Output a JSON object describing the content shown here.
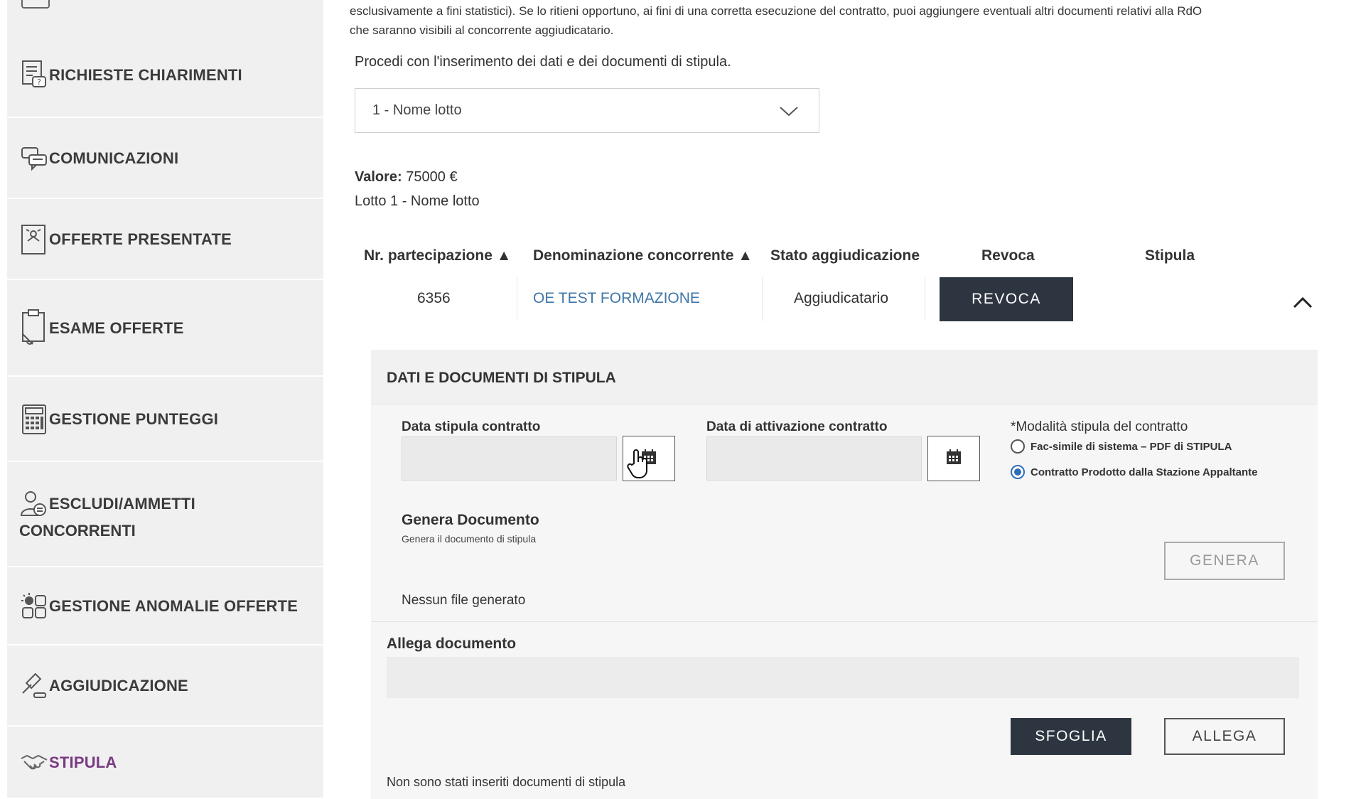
{
  "sidebar": {
    "items": [
      {
        "label": "RICHIESTE CHIARIMENTI",
        "icon": "document-question-icon"
      },
      {
        "label": "COMUNICAZIONI",
        "icon": "chat-bubbles-icon"
      },
      {
        "label": "OFFERTE PRESENTATE",
        "icon": "offer-document-icon"
      },
      {
        "label": "ESAME OFFERTE",
        "icon": "clipboard-review-icon"
      },
      {
        "label": "GESTIONE PUNTEGGI",
        "icon": "calculator-icon"
      },
      {
        "label": "ESCLUDI/AMMETTI",
        "label2": "CONCORRENTI",
        "icon": "user-filter-icon"
      },
      {
        "label": "GESTIONE ANOMALIE OFFERTE",
        "icon": "anomaly-grid-icon"
      },
      {
        "label": "AGGIUDICAZIONE",
        "icon": "gavel-icon"
      },
      {
        "label": "STIPULA",
        "icon": "handshake-icon"
      }
    ],
    "active_color": "#7a3a83"
  },
  "main": {
    "intro_line1": "esclusivamente a fini statistici). Se lo ritieni opportuno, ai fini di una corretta esecuzione del contratto, puoi aggiungere eventuali altri documenti relativi alla RdO",
    "intro_line2": "che saranno visibili al concorrente aggiudicatario.",
    "proceed": "Procedi con l'inserimento dei dati e dei documenti di stipula.",
    "lot_select": "1 - Nome lotto",
    "valore_label": "Valore:",
    "valore_value": "75000 €",
    "lotto": "Lotto 1 - Nome lotto"
  },
  "table": {
    "headers": [
      "Nr. partecipazione ▲",
      "Denominazione concorrente ▲",
      "Stato aggiudicazione",
      "Revoca",
      "Stipula"
    ],
    "row": {
      "nr": "6356",
      "denominazione": "OE TEST FORMAZIONE",
      "stato": "Aggiudicatario",
      "revoca_button": "REVOCA"
    }
  },
  "panel": {
    "title": "DATI E DOCUMENTI DI STIPULA",
    "data_stipula_label": "Data stipula contratto",
    "data_stipula_value": "",
    "data_attivazione_label": "Data di attivazione contratto",
    "data_attivazione_value": "",
    "modalita_label": "*Modalità stipula del contratto",
    "option1": "Fac-simile di sistema – PDF di STIPULA",
    "option2": "Contratto Prodotto dalla Stazione Appaltante",
    "selected_option": 2,
    "genera_title": "Genera Documento",
    "genera_sub": "Genera il documento di stipula",
    "genera_button": "GENERA",
    "nessun_file": "Nessun file generato",
    "allega_title": "Allega documento",
    "sfoglia_button": "SFOGLIA",
    "allega_button": "ALLEGA",
    "no_docs": "Non sono stati inseriti documenti di stipula"
  },
  "colors": {
    "dark_button": "#2d3640",
    "link": "#3f76a8",
    "radio_selected": "#2f6db5"
  }
}
